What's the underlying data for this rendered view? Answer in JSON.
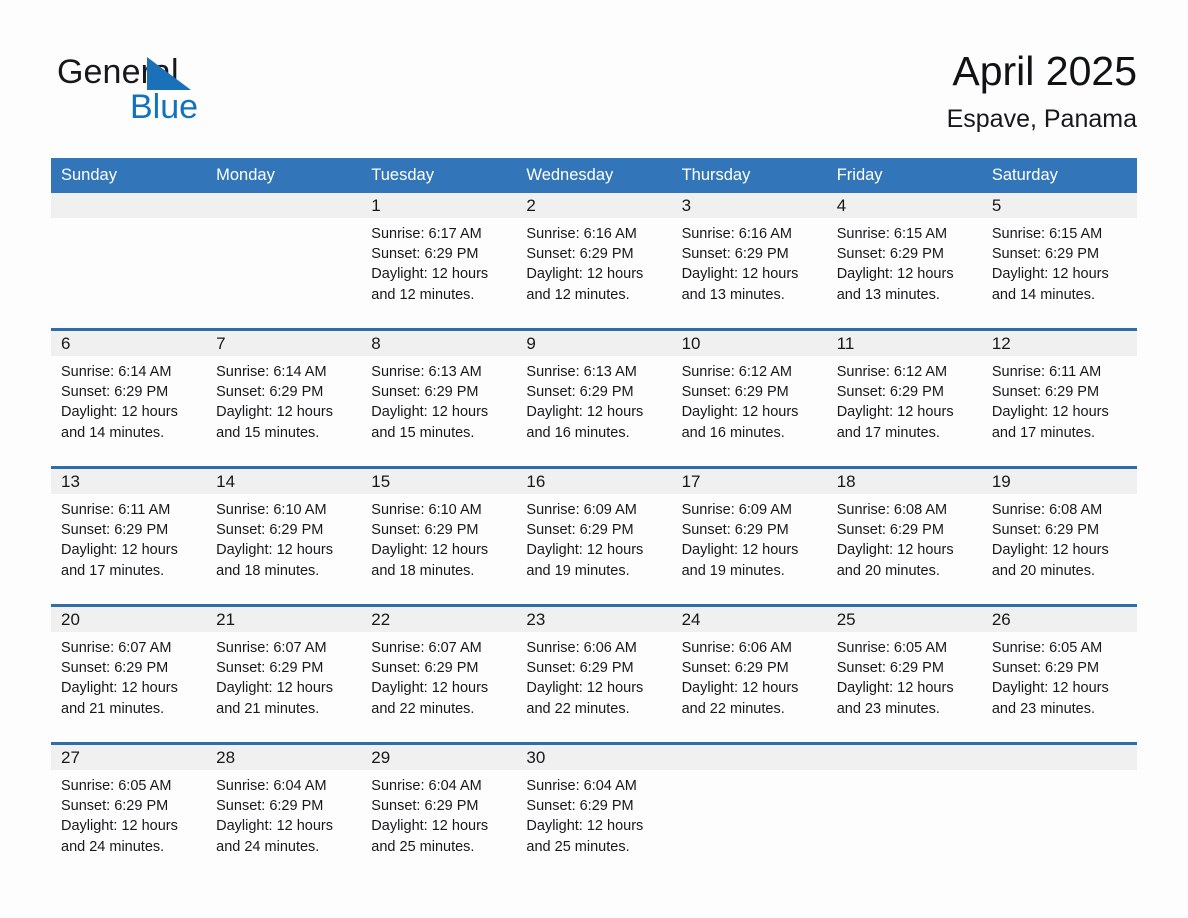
{
  "brand": {
    "name_part1": "General",
    "name_part2": "Blue",
    "triangle_color": "#1b71b8",
    "text_color_part2": "#1273bd"
  },
  "header": {
    "title": "April 2025",
    "location": "Espave, Panama"
  },
  "theme": {
    "header_blue": "#3275b8",
    "week_divider_blue": "#2e6da8",
    "daynum_band": "#f0f0f0",
    "page_background": "#fdfdfd",
    "text": "#17181a"
  },
  "weekday_headers": [
    "Sunday",
    "Monday",
    "Tuesday",
    "Wednesday",
    "Thursday",
    "Friday",
    "Saturday"
  ],
  "weeks": [
    [
      {
        "day": "",
        "empty": true,
        "sunrise": "",
        "sunset": "",
        "daylight_l1": "",
        "daylight_l2": ""
      },
      {
        "day": "",
        "empty": true,
        "sunrise": "",
        "sunset": "",
        "daylight_l1": "",
        "daylight_l2": ""
      },
      {
        "day": "1",
        "empty": false,
        "sunrise": "Sunrise: 6:17 AM",
        "sunset": "Sunset: 6:29 PM",
        "daylight_l1": "Daylight: 12 hours",
        "daylight_l2": "and 12 minutes."
      },
      {
        "day": "2",
        "empty": false,
        "sunrise": "Sunrise: 6:16 AM",
        "sunset": "Sunset: 6:29 PM",
        "daylight_l1": "Daylight: 12 hours",
        "daylight_l2": "and 12 minutes."
      },
      {
        "day": "3",
        "empty": false,
        "sunrise": "Sunrise: 6:16 AM",
        "sunset": "Sunset: 6:29 PM",
        "daylight_l1": "Daylight: 12 hours",
        "daylight_l2": "and 13 minutes."
      },
      {
        "day": "4",
        "empty": false,
        "sunrise": "Sunrise: 6:15 AM",
        "sunset": "Sunset: 6:29 PM",
        "daylight_l1": "Daylight: 12 hours",
        "daylight_l2": "and 13 minutes."
      },
      {
        "day": "5",
        "empty": false,
        "sunrise": "Sunrise: 6:15 AM",
        "sunset": "Sunset: 6:29 PM",
        "daylight_l1": "Daylight: 12 hours",
        "daylight_l2": "and 14 minutes."
      }
    ],
    [
      {
        "day": "6",
        "empty": false,
        "sunrise": "Sunrise: 6:14 AM",
        "sunset": "Sunset: 6:29 PM",
        "daylight_l1": "Daylight: 12 hours",
        "daylight_l2": "and 14 minutes."
      },
      {
        "day": "7",
        "empty": false,
        "sunrise": "Sunrise: 6:14 AM",
        "sunset": "Sunset: 6:29 PM",
        "daylight_l1": "Daylight: 12 hours",
        "daylight_l2": "and 15 minutes."
      },
      {
        "day": "8",
        "empty": false,
        "sunrise": "Sunrise: 6:13 AM",
        "sunset": "Sunset: 6:29 PM",
        "daylight_l1": "Daylight: 12 hours",
        "daylight_l2": "and 15 minutes."
      },
      {
        "day": "9",
        "empty": false,
        "sunrise": "Sunrise: 6:13 AM",
        "sunset": "Sunset: 6:29 PM",
        "daylight_l1": "Daylight: 12 hours",
        "daylight_l2": "and 16 minutes."
      },
      {
        "day": "10",
        "empty": false,
        "sunrise": "Sunrise: 6:12 AM",
        "sunset": "Sunset: 6:29 PM",
        "daylight_l1": "Daylight: 12 hours",
        "daylight_l2": "and 16 minutes."
      },
      {
        "day": "11",
        "empty": false,
        "sunrise": "Sunrise: 6:12 AM",
        "sunset": "Sunset: 6:29 PM",
        "daylight_l1": "Daylight: 12 hours",
        "daylight_l2": "and 17 minutes."
      },
      {
        "day": "12",
        "empty": false,
        "sunrise": "Sunrise: 6:11 AM",
        "sunset": "Sunset: 6:29 PM",
        "daylight_l1": "Daylight: 12 hours",
        "daylight_l2": "and 17 minutes."
      }
    ],
    [
      {
        "day": "13",
        "empty": false,
        "sunrise": "Sunrise: 6:11 AM",
        "sunset": "Sunset: 6:29 PM",
        "daylight_l1": "Daylight: 12 hours",
        "daylight_l2": "and 17 minutes."
      },
      {
        "day": "14",
        "empty": false,
        "sunrise": "Sunrise: 6:10 AM",
        "sunset": "Sunset: 6:29 PM",
        "daylight_l1": "Daylight: 12 hours",
        "daylight_l2": "and 18 minutes."
      },
      {
        "day": "15",
        "empty": false,
        "sunrise": "Sunrise: 6:10 AM",
        "sunset": "Sunset: 6:29 PM",
        "daylight_l1": "Daylight: 12 hours",
        "daylight_l2": "and 18 minutes."
      },
      {
        "day": "16",
        "empty": false,
        "sunrise": "Sunrise: 6:09 AM",
        "sunset": "Sunset: 6:29 PM",
        "daylight_l1": "Daylight: 12 hours",
        "daylight_l2": "and 19 minutes."
      },
      {
        "day": "17",
        "empty": false,
        "sunrise": "Sunrise: 6:09 AM",
        "sunset": "Sunset: 6:29 PM",
        "daylight_l1": "Daylight: 12 hours",
        "daylight_l2": "and 19 minutes."
      },
      {
        "day": "18",
        "empty": false,
        "sunrise": "Sunrise: 6:08 AM",
        "sunset": "Sunset: 6:29 PM",
        "daylight_l1": "Daylight: 12 hours",
        "daylight_l2": "and 20 minutes."
      },
      {
        "day": "19",
        "empty": false,
        "sunrise": "Sunrise: 6:08 AM",
        "sunset": "Sunset: 6:29 PM",
        "daylight_l1": "Daylight: 12 hours",
        "daylight_l2": "and 20 minutes."
      }
    ],
    [
      {
        "day": "20",
        "empty": false,
        "sunrise": "Sunrise: 6:07 AM",
        "sunset": "Sunset: 6:29 PM",
        "daylight_l1": "Daylight: 12 hours",
        "daylight_l2": "and 21 minutes."
      },
      {
        "day": "21",
        "empty": false,
        "sunrise": "Sunrise: 6:07 AM",
        "sunset": "Sunset: 6:29 PM",
        "daylight_l1": "Daylight: 12 hours",
        "daylight_l2": "and 21 minutes."
      },
      {
        "day": "22",
        "empty": false,
        "sunrise": "Sunrise: 6:07 AM",
        "sunset": "Sunset: 6:29 PM",
        "daylight_l1": "Daylight: 12 hours",
        "daylight_l2": "and 22 minutes."
      },
      {
        "day": "23",
        "empty": false,
        "sunrise": "Sunrise: 6:06 AM",
        "sunset": "Sunset: 6:29 PM",
        "daylight_l1": "Daylight: 12 hours",
        "daylight_l2": "and 22 minutes."
      },
      {
        "day": "24",
        "empty": false,
        "sunrise": "Sunrise: 6:06 AM",
        "sunset": "Sunset: 6:29 PM",
        "daylight_l1": "Daylight: 12 hours",
        "daylight_l2": "and 22 minutes."
      },
      {
        "day": "25",
        "empty": false,
        "sunrise": "Sunrise: 6:05 AM",
        "sunset": "Sunset: 6:29 PM",
        "daylight_l1": "Daylight: 12 hours",
        "daylight_l2": "and 23 minutes."
      },
      {
        "day": "26",
        "empty": false,
        "sunrise": "Sunrise: 6:05 AM",
        "sunset": "Sunset: 6:29 PM",
        "daylight_l1": "Daylight: 12 hours",
        "daylight_l2": "and 23 minutes."
      }
    ],
    [
      {
        "day": "27",
        "empty": false,
        "sunrise": "Sunrise: 6:05 AM",
        "sunset": "Sunset: 6:29 PM",
        "daylight_l1": "Daylight: 12 hours",
        "daylight_l2": "and 24 minutes."
      },
      {
        "day": "28",
        "empty": false,
        "sunrise": "Sunrise: 6:04 AM",
        "sunset": "Sunset: 6:29 PM",
        "daylight_l1": "Daylight: 12 hours",
        "daylight_l2": "and 24 minutes."
      },
      {
        "day": "29",
        "empty": false,
        "sunrise": "Sunrise: 6:04 AM",
        "sunset": "Sunset: 6:29 PM",
        "daylight_l1": "Daylight: 12 hours",
        "daylight_l2": "and 25 minutes."
      },
      {
        "day": "30",
        "empty": false,
        "sunrise": "Sunrise: 6:04 AM",
        "sunset": "Sunset: 6:29 PM",
        "daylight_l1": "Daylight: 12 hours",
        "daylight_l2": "and 25 minutes."
      },
      {
        "day": "",
        "empty": true,
        "sunrise": "",
        "sunset": "",
        "daylight_l1": "",
        "daylight_l2": ""
      },
      {
        "day": "",
        "empty": true,
        "sunrise": "",
        "sunset": "",
        "daylight_l1": "",
        "daylight_l2": ""
      },
      {
        "day": "",
        "empty": true,
        "sunrise": "",
        "sunset": "",
        "daylight_l1": "",
        "daylight_l2": ""
      }
    ]
  ]
}
